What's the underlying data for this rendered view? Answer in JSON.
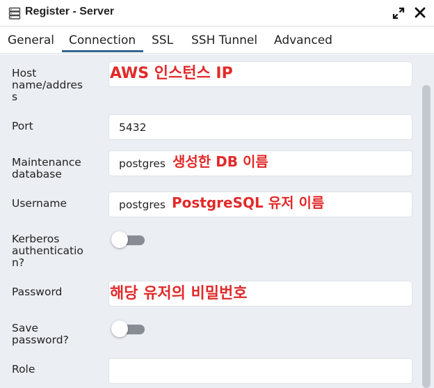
{
  "window": {
    "title": "Register - Server",
    "icon": "server-icon",
    "expand_icon": "expand-icon",
    "close_icon": "close-icon"
  },
  "tabs": [
    {
      "label": "General",
      "active": false
    },
    {
      "label": "Connection",
      "active": true
    },
    {
      "label": "SSL",
      "active": false
    },
    {
      "label": "SSH Tunnel",
      "active": false
    },
    {
      "label": "Advanced",
      "active": false
    }
  ],
  "form": {
    "host": {
      "label_lines": [
        "Host",
        "name/addres",
        "s"
      ],
      "value": ""
    },
    "port": {
      "label_lines": [
        "Port"
      ],
      "value": "5432"
    },
    "maintenance_db": {
      "label_lines": [
        "Maintenance",
        "database"
      ],
      "value": "postgres"
    },
    "username": {
      "label_lines": [
        "Username"
      ],
      "value": "postgres"
    },
    "kerberos": {
      "label_lines": [
        "Kerberos",
        "authenticatio",
        "n?"
      ],
      "enabled": false
    },
    "password": {
      "label_lines": [
        "Password"
      ],
      "value": ""
    },
    "save_password": {
      "label_lines": [
        "Save",
        "password?"
      ],
      "enabled": false
    },
    "role": {
      "label_lines": [
        "Role"
      ],
      "value": ""
    }
  },
  "annotations": {
    "host": "AWS 인스턴스 IP",
    "maintenance_db": "생성한 DB 이름",
    "username": "PostgreSQL 유저 이름",
    "password": "해당 유저의 비밀번호"
  },
  "colors": {
    "annotation": "#e12a2a",
    "tab_active_underline": "#326690",
    "content_bg": "#ebeef3",
    "toggle_off": "#888c93"
  }
}
